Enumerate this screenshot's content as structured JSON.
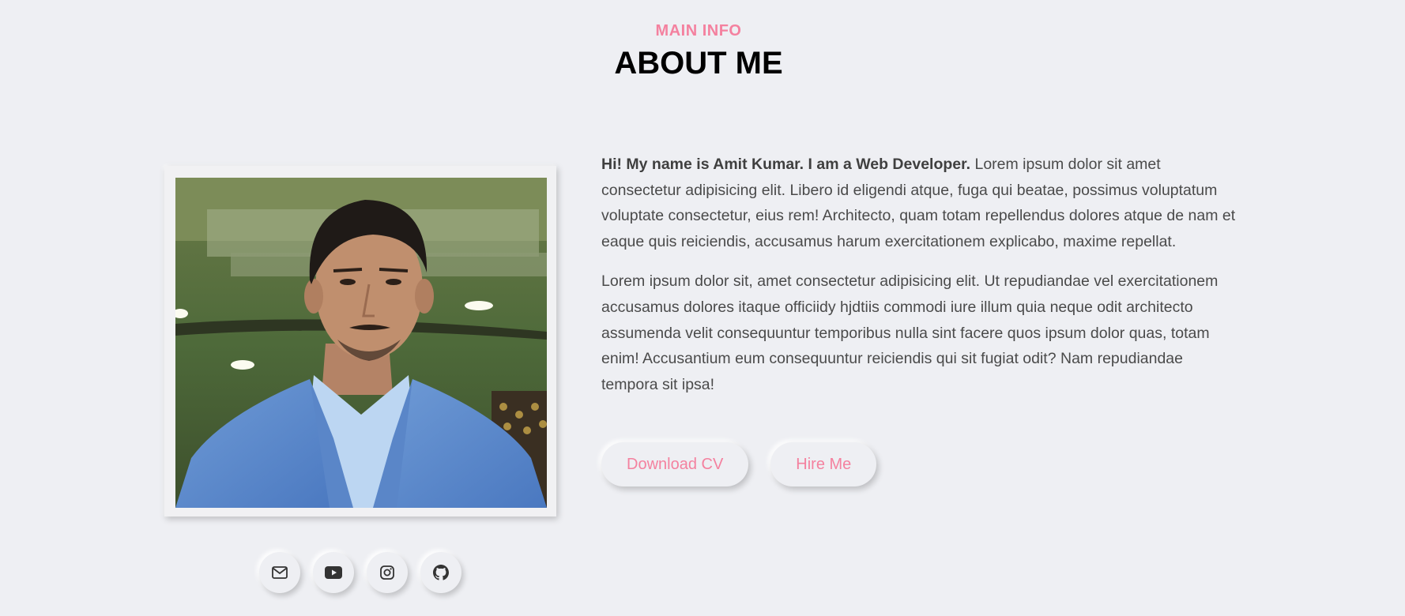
{
  "header": {
    "subtitle": "MAIN INFO",
    "title": "ABOUT ME"
  },
  "about": {
    "intro_bold": "Hi! My name is Amit Kumar. I am a Web Developer.",
    "intro_rest": " Lorem ipsum dolor sit amet consectetur adipisicing elit. Libero id eligendi atque, fuga qui beatae, possimus voluptatum voluptate consectetur, eius rem! Architecto, quam totam repellendus dolores atque de nam et eaque quis reiciendis, accusamus harum exercitationem explicabo, maxime repellat.",
    "paragraph2": "Lorem ipsum dolor sit, amet consectetur adipisicing elit. Ut repudiandae vel exercitationem accusamus dolores itaque officiidy hjdtiis commodi iure illum quia neque odit architecto assumenda velit consequuntur temporibus nulla sint facere quos ipsum dolor quas, totam enim! Accusantium eum consequuntur reiciendis qui sit fugiat odit? Nam repudiandae tempora sit ipsa!"
  },
  "buttons": {
    "download_cv": "Download CV",
    "hire_me": "Hire Me"
  },
  "socials": [
    {
      "icon": "envelope-icon"
    },
    {
      "icon": "youtube-icon"
    },
    {
      "icon": "instagram-icon"
    },
    {
      "icon": "github-icon"
    }
  ],
  "colors": {
    "accent": "#f4819f",
    "background": "#eeeff3",
    "text": "#4a4a4a"
  }
}
